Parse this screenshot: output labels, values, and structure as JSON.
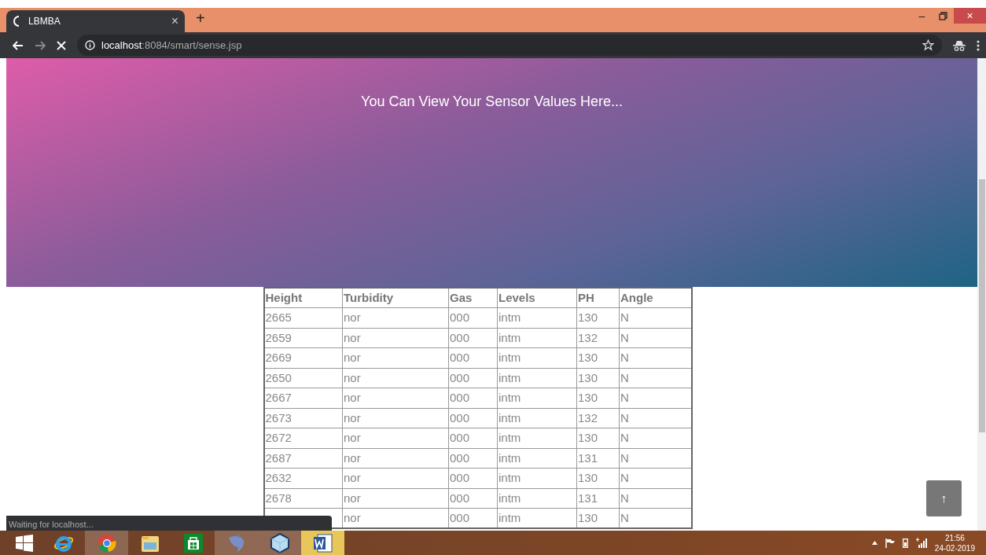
{
  "browser": {
    "tab_title": "LBMBA",
    "tab_close": "×",
    "new_tab": "+",
    "window_minimize": "–",
    "window_close": "×",
    "url_host": "localhost",
    "url_path": ":8084/smart/sense.jsp",
    "status": "Waiting for localhost..."
  },
  "hero": {
    "subheading": "You Can View Your Sensor Values Here..."
  },
  "table": {
    "columns": [
      "Height",
      "Turbidity",
      "Gas",
      "Levels",
      "PH",
      "Angle"
    ],
    "rows": [
      [
        "2665",
        "nor",
        "000",
        "intm",
        "130",
        "N"
      ],
      [
        "2659",
        "nor",
        "000",
        "intm",
        "132",
        "N"
      ],
      [
        "2669",
        "nor",
        "000",
        "intm",
        "130",
        "N"
      ],
      [
        "2650",
        "nor",
        "000",
        "intm",
        "130",
        "N"
      ],
      [
        "2667",
        "nor",
        "000",
        "intm",
        "130",
        "N"
      ],
      [
        "2673",
        "nor",
        "000",
        "intm",
        "132",
        "N"
      ],
      [
        "2672",
        "nor",
        "000",
        "intm",
        "130",
        "N"
      ],
      [
        "2687",
        "nor",
        "000",
        "intm",
        "131",
        "N"
      ],
      [
        "2632",
        "nor",
        "000",
        "intm",
        "130",
        "N"
      ],
      [
        "2678",
        "nor",
        "000",
        "intm",
        "131",
        "N"
      ],
      [
        null,
        "nor",
        "000",
        "intm",
        "130",
        "N"
      ]
    ]
  },
  "back_to_top": "↑",
  "taskbar": {
    "apps": [
      {
        "kind": "ie",
        "selected": false
      },
      {
        "kind": "chrome",
        "selected": true
      },
      {
        "kind": "folder",
        "selected": false
      },
      {
        "kind": "store",
        "selected": false
      },
      {
        "kind": "dolphin",
        "selected": true
      },
      {
        "kind": "cube",
        "selected": true
      },
      {
        "kind": "word",
        "selected": true
      }
    ],
    "time": "21:56",
    "date": "24-02-2019"
  }
}
